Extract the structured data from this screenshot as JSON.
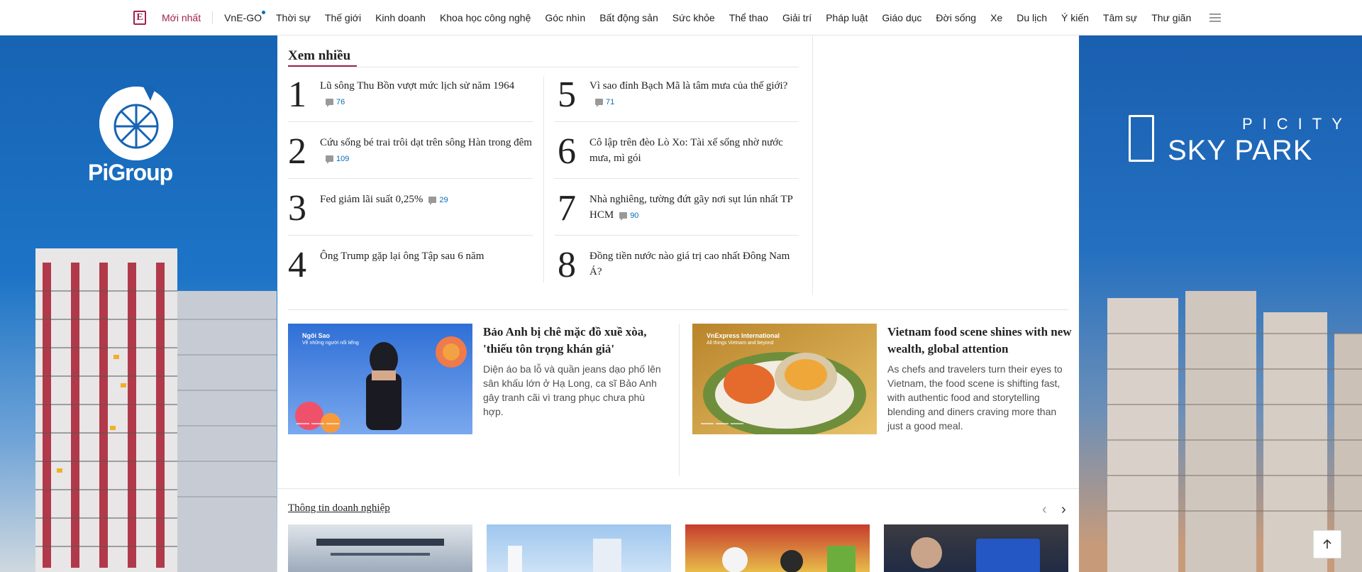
{
  "nav": {
    "items": [
      {
        "label": "Mới nhất",
        "active": true
      },
      {
        "label": "VnE-GO",
        "dot": true
      },
      {
        "label": "Thời sự"
      },
      {
        "label": "Thế giới"
      },
      {
        "label": "Kinh doanh"
      },
      {
        "label": "Khoa học công nghệ"
      },
      {
        "label": "Góc nhìn"
      },
      {
        "label": "Bất động sản"
      },
      {
        "label": "Sức khỏe"
      },
      {
        "label": "Thể thao"
      },
      {
        "label": "Giải trí"
      },
      {
        "label": "Pháp luật"
      },
      {
        "label": "Giáo dục"
      },
      {
        "label": "Đời sống"
      },
      {
        "label": "Xe"
      },
      {
        "label": "Du lịch"
      },
      {
        "label": "Ý kiến"
      },
      {
        "label": "Tâm sự"
      },
      {
        "label": "Thư giãn"
      }
    ]
  },
  "banners": {
    "left_brand": "PiGroup",
    "right_brand_top": "PICITY",
    "right_brand_bottom": "SKY PARK"
  },
  "most_read": {
    "title": "Xem nhiều",
    "items": [
      {
        "num": "1",
        "text": "Lũ sông Thu Bồn vượt mức lịch sử năm 1964",
        "comments": "76"
      },
      {
        "num": "2",
        "text": "Cứu sống bé trai trôi dạt trên sông Hàn trong đêm",
        "comments": "109"
      },
      {
        "num": "3",
        "text": "Fed giảm lãi suất 0,25%",
        "comments": "29"
      },
      {
        "num": "4",
        "text": "Ông Trump gặp lại ông Tập sau 6 năm",
        "comments": ""
      },
      {
        "num": "5",
        "text": "Vì sao đỉnh Bạch Mã là tâm mưa của thế giới?",
        "comments": "71"
      },
      {
        "num": "6",
        "text": "Cô lập trên đèo Lò Xo: Tài xế sống nhờ nước mưa, mì gói",
        "comments": ""
      },
      {
        "num": "7",
        "text": "Nhà nghiêng, tường đứt gãy nơi sụt lún nhất TP HCM",
        "comments": "90"
      },
      {
        "num": "8",
        "text": "Đồng tiền nước nào giá trị cao nhất Đông Nam Á?",
        "comments": ""
      }
    ]
  },
  "stories": [
    {
      "title": "Bảo Anh bị chê mặc đồ xuề xòa, 'thiếu tôn trọng khán giả'",
      "desc": "Diện áo ba lỗ và quần jeans dạo phố lên sân khấu lớn ở Hạ Long, ca sĩ Bảo Anh gây tranh cãi vì trang phục chưa phù hợp.",
      "brand": "Ngôi Sao",
      "brand_sub": "Về những người nổi tiếng"
    },
    {
      "title": "Vietnam food scene shines with new wealth, global attention",
      "desc": "As chefs and travelers turn their eyes to Vietnam, the food scene is shifting fast, with authentic food and storytelling blending and diners craving more than just a good meal.",
      "brand": "VnExpress International",
      "brand_sub": "All things Vietnam and beyond"
    }
  ],
  "business": {
    "title": "Thông tin doanh nghiệp"
  },
  "colors": {
    "accent": "#9f224e",
    "link": "#076db6"
  }
}
